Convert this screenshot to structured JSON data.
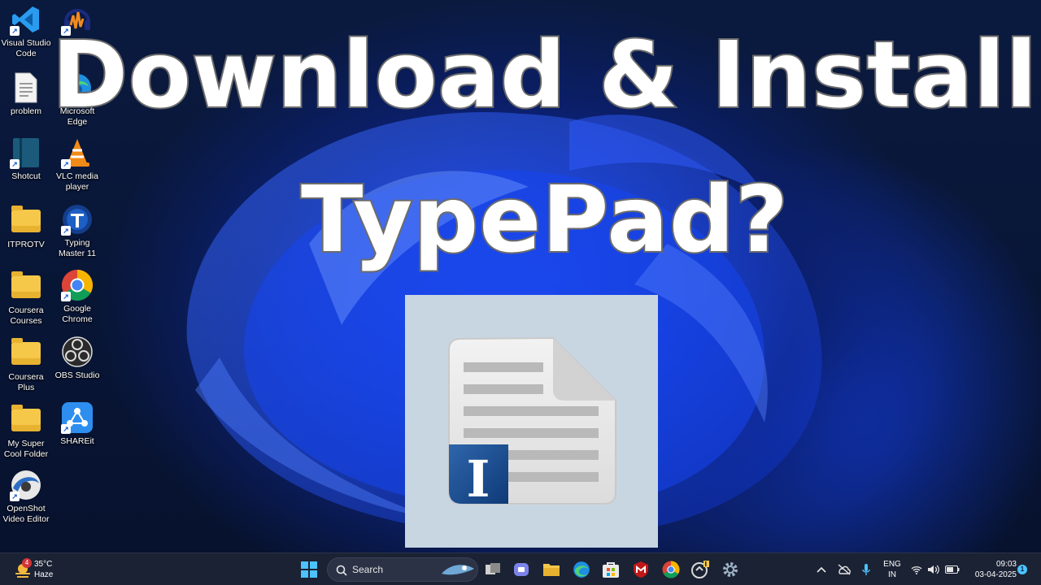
{
  "headline": {
    "line1": "Download & Install",
    "line2": "TypePad?"
  },
  "desktop_icons": [
    {
      "label": "Visual Studio Code",
      "icon": "vscode-icon"
    },
    {
      "label": "Audacity",
      "icon": "audacity-icon"
    },
    {
      "label": "problem",
      "icon": "text-file-icon"
    },
    {
      "label": "Microsoft Edge",
      "icon": "edge-icon"
    },
    {
      "label": "Shotcut",
      "icon": "shotcut-icon"
    },
    {
      "label": "VLC media player",
      "icon": "vlc-icon"
    },
    {
      "label": "ITPROTV",
      "icon": "folder-icon"
    },
    {
      "label": "Typing Master 11",
      "icon": "typing-master-icon"
    },
    {
      "label": "Coursera Courses",
      "icon": "folder-icon"
    },
    {
      "label": "Google Chrome",
      "icon": "chrome-icon"
    },
    {
      "label": "Coursera Plus",
      "icon": "folder-icon"
    },
    {
      "label": "OBS Studio",
      "icon": "obs-icon"
    },
    {
      "label": "My Super Cool Folder",
      "icon": "folder-icon"
    },
    {
      "label": "SHAREit",
      "icon": "shareit-icon"
    },
    {
      "label": "OpenShot Video Editor",
      "icon": "openshot-icon"
    }
  ],
  "logo": {
    "letter": "I",
    "icon": "typepad-document-icon"
  },
  "taskbar": {
    "weather": {
      "temp": "35°C",
      "condition": "Haze",
      "badge": "4"
    },
    "search_placeholder": "Search",
    "language": {
      "line1": "ENG",
      "line2": "IN"
    },
    "time": "09:03",
    "date": "03-04-2025",
    "notification_count": "1"
  },
  "colors": {
    "accent": "#1c4cff",
    "taskbar": "#1b2233",
    "logo_bg": "#c8d6e2"
  }
}
